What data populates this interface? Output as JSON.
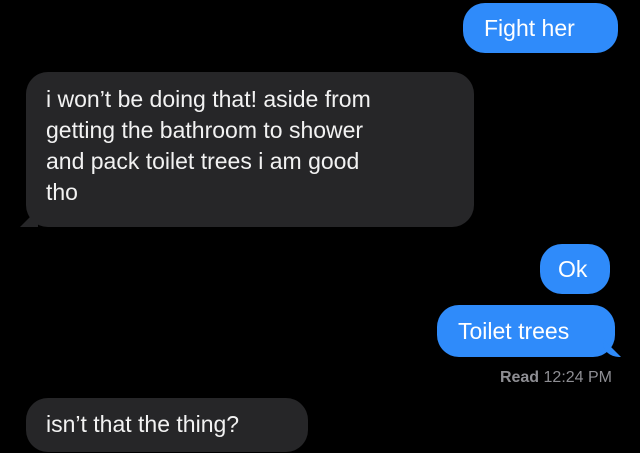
{
  "messages": [
    {
      "id": "m1",
      "side": "sent",
      "text": "Fight her"
    },
    {
      "id": "m2",
      "side": "received",
      "lines": [
        "i won’t be doing that! aside from",
        "getting the bathroom to shower",
        "and pack toilet trees i am good",
        "tho"
      ]
    },
    {
      "id": "m3",
      "side": "sent",
      "text": "Ok"
    },
    {
      "id": "m4",
      "side": "sent",
      "text": "Toilet trees"
    },
    {
      "id": "m5",
      "side": "received",
      "text": "isn’t that the thing?"
    }
  ],
  "receipt": {
    "label": "Read",
    "time": "12:24 PM"
  },
  "colors": {
    "background": "#000000",
    "sent_bubble": "#2f8bfa",
    "received_bubble": "#262628",
    "receipt_text": "#8e8e93"
  }
}
